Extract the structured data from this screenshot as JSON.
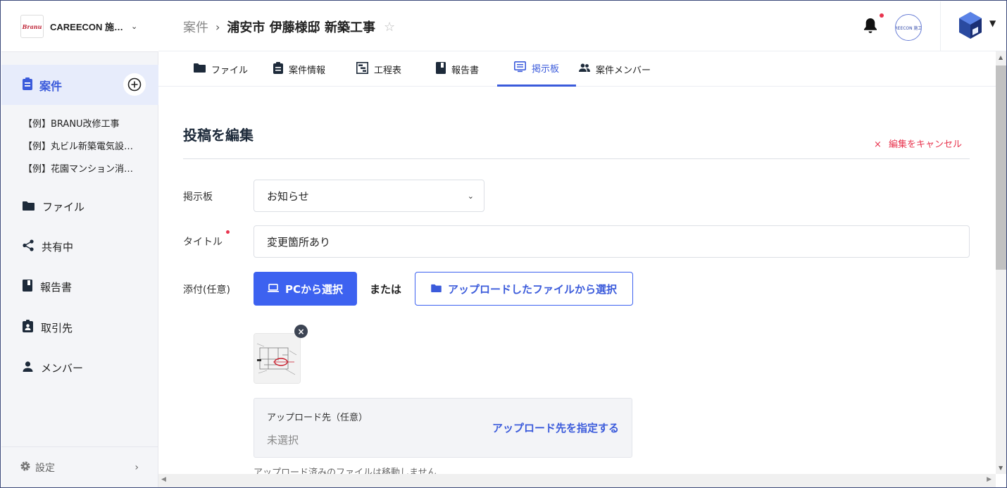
{
  "org": {
    "logo_text": "Branu",
    "name": "CAREECON 施…"
  },
  "sidebar": {
    "active_item": {
      "label": "案件",
      "icon": "clipboard-icon"
    },
    "projects": [
      "【例】BRANU改修工事",
      "【例】丸ビル新築電気設…",
      "【例】花園マンション消…"
    ],
    "items": [
      {
        "label": "ファイル",
        "icon": "folder-icon"
      },
      {
        "label": "共有中",
        "icon": "share-icon"
      },
      {
        "label": "報告書",
        "icon": "book-icon"
      },
      {
        "label": "取引先",
        "icon": "contact-badge-icon"
      },
      {
        "label": "メンバー",
        "icon": "person-icon"
      }
    ],
    "settings_label": "設定"
  },
  "header": {
    "breadcrumb_parent": "案件",
    "breadcrumb_current": "浦安市 伊藤様邸 新築工事",
    "company_badge": "REECON 施工",
    "accent": "#3b5bdb",
    "alert": "#e8344e"
  },
  "tabs": [
    {
      "label": "ファイル",
      "icon": "folder-icon"
    },
    {
      "label": "案件情報",
      "icon": "clipboard-icon"
    },
    {
      "label": "工程表",
      "icon": "gantt-icon"
    },
    {
      "label": "報告書",
      "icon": "book-icon"
    },
    {
      "label": "掲示板",
      "icon": "board-icon",
      "active": true
    },
    {
      "label": "案件メンバー",
      "icon": "people-icon"
    }
  ],
  "form": {
    "title": "投稿を編集",
    "cancel_label": "編集をキャンセル",
    "board_label": "掲示板",
    "board_value": "お知らせ",
    "title_label": "タイトル",
    "title_value": "変更箇所あり",
    "attach_label": "添付(任意)",
    "pc_button": "PCから選択",
    "or_text": "または",
    "uploaded_button": "アップロードしたファイルから選択",
    "upload_dest_title": "アップロード先（任意）",
    "upload_dest_value": "未選択",
    "upload_dest_link": "アップロード先を指定する",
    "note": "アップロード済みのファイルは移動しません"
  }
}
